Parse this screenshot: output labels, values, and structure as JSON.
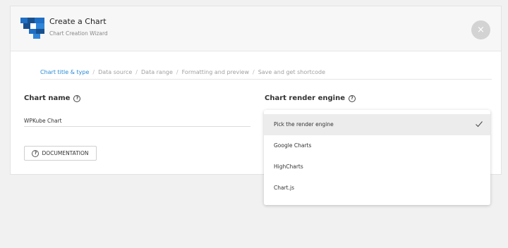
{
  "header": {
    "title": "Create a Chart",
    "subtitle": "Chart Creation Wizard",
    "close_icon": "×"
  },
  "breadcrumb": {
    "steps": [
      "Chart title & type",
      "Data source",
      "Data range",
      "Formatting and preview",
      "Save and get shortcode"
    ],
    "separator": "/",
    "active_index": 0
  },
  "chart_name": {
    "label": "Chart name",
    "help_icon": "?",
    "value": "WPKube Chart"
  },
  "render_engine": {
    "label": "Chart render engine",
    "help_icon": "?",
    "options": [
      "Pick the render engine",
      "Google Charts",
      "HighCharts",
      "Chart.js"
    ],
    "selected_index": 0
  },
  "documentation_button": {
    "label": "DOCUMENTATION",
    "icon": "?"
  },
  "colors": {
    "accent": "#2a8bd6",
    "logo_blue": "#1f6fc5",
    "logo_dark": "#17508f"
  }
}
